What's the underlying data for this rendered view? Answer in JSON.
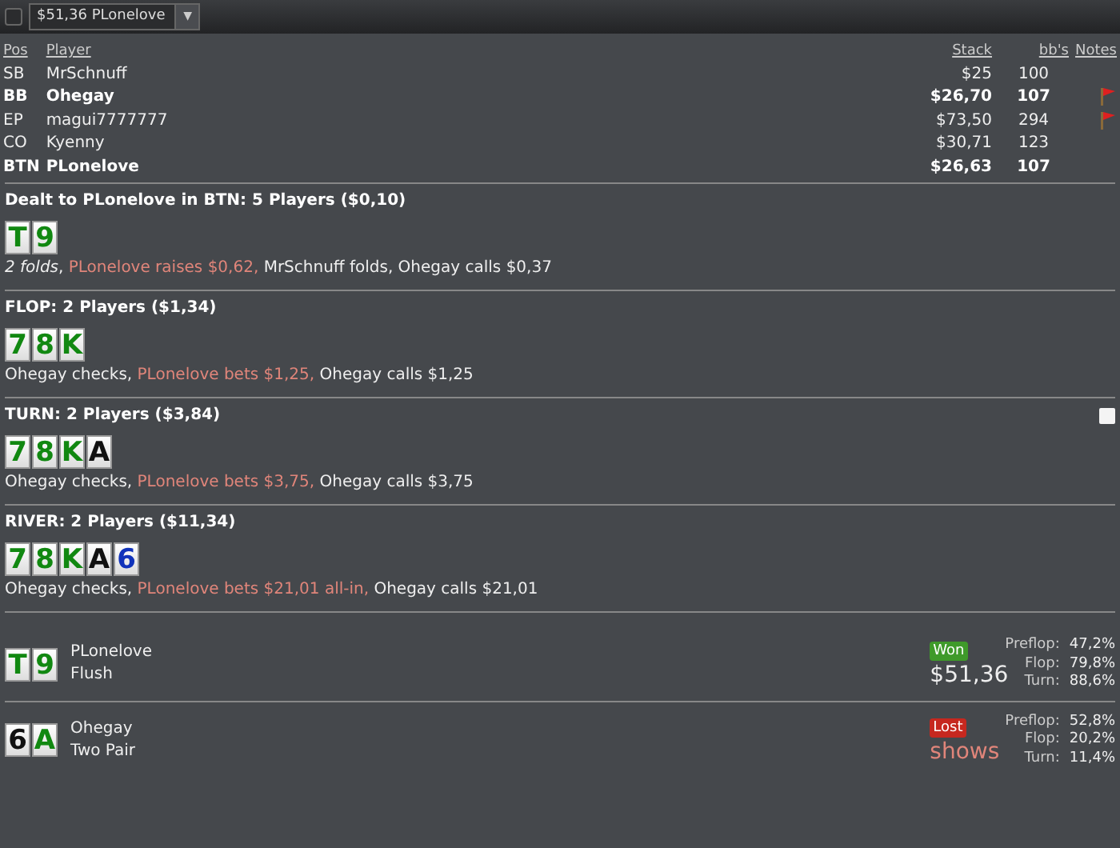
{
  "toolbar": {
    "checked": false,
    "selector": {
      "value": "$51,36 PLonelove",
      "caret": "▼"
    }
  },
  "players": {
    "columns": [
      "Pos",
      "Player",
      "Stack",
      "bb's",
      "Notes"
    ],
    "rows": [
      {
        "pos": "SB",
        "name": "MrSchnuff",
        "stack": "$25",
        "bbs": "100",
        "bold": false,
        "note": false
      },
      {
        "pos": "BB",
        "name": "Ohegay",
        "stack": "$26,70",
        "bbs": "107",
        "bold": true,
        "note": true
      },
      {
        "pos": "EP",
        "name": "magui7777777",
        "stack": "$73,50",
        "bbs": "294",
        "bold": false,
        "note": true
      },
      {
        "pos": "CO",
        "name": "Kyenny",
        "stack": "$30,71",
        "bbs": "123",
        "bold": false,
        "note": false
      },
      {
        "pos": "BTN",
        "name": "PLonelove",
        "stack": "$26,63",
        "bbs": "107",
        "bold": true,
        "note": false
      }
    ]
  },
  "streets": [
    {
      "title": "Dealt to PLonelove in BTN: 5 Players ($0,10)",
      "note": false,
      "cards": [
        {
          "rank": "T",
          "color": "#118811"
        },
        {
          "rank": "9",
          "color": "#118811"
        }
      ],
      "actions": [
        {
          "text": "*2 folds*, ",
          "hero": false
        },
        {
          "text": "PLonelove raises $0,62, ",
          "hero": true
        },
        {
          "text": "MrSchnuff folds, Ohegay calls $0,37",
          "hero": false
        }
      ]
    },
    {
      "title": "FLOP: 2 Players ($1,34)",
      "note": false,
      "cards": [
        {
          "rank": "7",
          "color": "#118811"
        },
        {
          "rank": "8",
          "color": "#118811"
        },
        {
          "rank": "K",
          "color": "#118811"
        }
      ],
      "actions": [
        {
          "text": "Ohegay checks, ",
          "hero": false
        },
        {
          "text": "PLonelove bets $1,25, ",
          "hero": true
        },
        {
          "text": "Ohegay calls $1,25",
          "hero": false
        }
      ]
    },
    {
      "title": "TURN: 2 Players ($3,84)",
      "note": true,
      "cards": [
        {
          "rank": "7",
          "color": "#118811"
        },
        {
          "rank": "8",
          "color": "#118811"
        },
        {
          "rank": "K",
          "color": "#118811"
        },
        {
          "rank": "A",
          "color": "#111111"
        }
      ],
      "actions": [
        {
          "text": "Ohegay checks, ",
          "hero": false
        },
        {
          "text": "PLonelove bets $3,75, ",
          "hero": true
        },
        {
          "text": "Ohegay calls $3,75",
          "hero": false
        }
      ]
    },
    {
      "title": "RIVER: 2 Players ($11,34)",
      "note": false,
      "cards": [
        {
          "rank": "7",
          "color": "#118811"
        },
        {
          "rank": "8",
          "color": "#118811"
        },
        {
          "rank": "K",
          "color": "#118811"
        },
        {
          "rank": "A",
          "color": "#111111"
        },
        {
          "rank": "6",
          "color": "#1133bb"
        }
      ],
      "actions": [
        {
          "text": "Ohegay checks, ",
          "hero": false
        },
        {
          "text": "PLonelove bets $21,01 all-in, ",
          "hero": true
        },
        {
          "text": "Ohegay calls $21,01",
          "hero": false
        }
      ]
    }
  ],
  "results": [
    {
      "cards": [
        {
          "rank": "T",
          "color": "#118811"
        },
        {
          "rank": "9",
          "color": "#118811"
        }
      ],
      "name": "PLonelove",
      "hand": "Flush",
      "outcome": "Won",
      "kind": "won",
      "amount": "$51,36",
      "equity": [
        {
          "label": "Preflop:",
          "value": "47,2%"
        },
        {
          "label": "Flop:",
          "value": "79,8%"
        },
        {
          "label": "Turn:",
          "value": "88,6%"
        }
      ]
    },
    {
      "cards": [
        {
          "rank": "6",
          "color": "#111111"
        },
        {
          "rank": "A",
          "color": "#118811"
        }
      ],
      "name": "Ohegay",
      "hand": "Two Pair",
      "outcome": "Lost",
      "kind": "lost",
      "amount": "shows",
      "equity": [
        {
          "label": "Preflop:",
          "value": "52,8%"
        },
        {
          "label": "Flop:",
          "value": "20,2%"
        },
        {
          "label": "Turn:",
          "value": "11,4%"
        }
      ]
    }
  ]
}
